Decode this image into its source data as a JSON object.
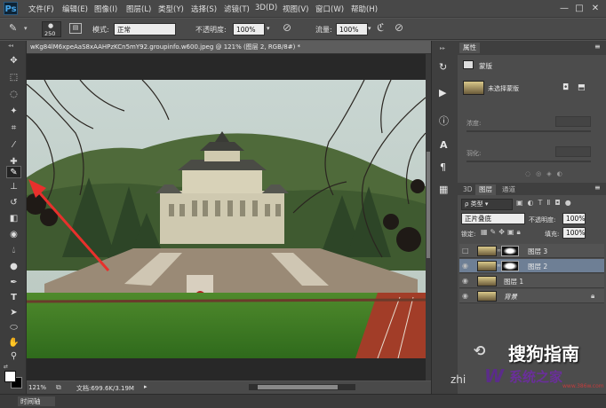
{
  "app": {
    "logo": "Ps"
  },
  "menu": [
    "文件(F)",
    "编辑(E)",
    "图像(I)",
    "图层(L)",
    "类型(Y)",
    "选择(S)",
    "滤镜(T)",
    "3D(D)",
    "视图(V)",
    "窗口(W)",
    "帮助(H)"
  ],
  "window_controls": {
    "minimize": "—",
    "maximize": "□",
    "close": "✕"
  },
  "options": {
    "brush_size": "250",
    "mode_label": "模式:",
    "mode_value": "正常",
    "opacity_label": "不透明度:",
    "opacity_value": "100%",
    "flow_label": "流量:",
    "flow_value": "100%"
  },
  "document": {
    "tab_title": "wKg84lM6xpeAaS8xAAHPzKCn5mY92.groupinfo.w600.jpeg @ 121% (图层 2, RGB/8#) *",
    "zoom": "121%",
    "doc_info": "文档:699.6K/3.19M"
  },
  "timeline": {
    "label": "时间轴"
  },
  "properties": {
    "tab": "属性",
    "section": "蒙版",
    "mask_label": "未选择蒙版",
    "density_label": "浓度:",
    "feather_label": "羽化:"
  },
  "layers": {
    "tabs": [
      "3D",
      "图层",
      "通道"
    ],
    "filter_kind": "类型",
    "blend_mode": "正片叠底",
    "opacity_label": "不透明度:",
    "opacity_value": "100%",
    "lock_label": "锁定:",
    "fill_label": "填充:",
    "fill_value": "100%",
    "items": [
      {
        "name": "图层 3",
        "has_mask": true,
        "visible": false,
        "selected": false
      },
      {
        "name": "图层 2",
        "has_mask": true,
        "visible": true,
        "selected": true
      },
      {
        "name": "图层 1",
        "has_mask": false,
        "visible": true,
        "selected": false
      },
      {
        "name": "背景",
        "has_mask": false,
        "visible": true,
        "selected": false,
        "locked": true
      }
    ]
  },
  "watermark": {
    "text": "搜狗指南",
    "site": "zhi",
    "logo_text": "系统之家",
    "url": "www.386w.com"
  },
  "colors": {
    "accent": "#6e7f95",
    "arrow": "#e8302c"
  }
}
